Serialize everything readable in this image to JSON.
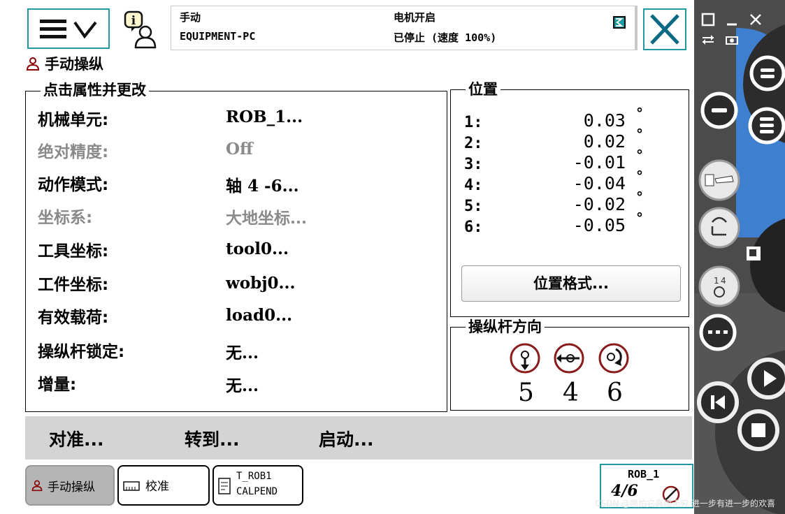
{
  "header": {
    "mode": "手动",
    "system": "EQUIPMENT-PC",
    "motor_state": "电机开启",
    "run_state": "已停止 (速度 100%)"
  },
  "page": {
    "title": "手动操纵"
  },
  "properties": {
    "group_title": "点击属性并更改",
    "rows": [
      {
        "label": "机械单元:",
        "value": "ROB_1...",
        "enabled": true
      },
      {
        "label": "绝对精度:",
        "value": "Off",
        "enabled": false
      },
      {
        "label": "动作模式:",
        "value": "轴 4 -6...",
        "enabled": true
      },
      {
        "label": "坐标系:",
        "value": "大地坐标...",
        "enabled": false
      },
      {
        "label": "工具坐标:",
        "value": "tool0...",
        "enabled": true
      },
      {
        "label": "工件坐标:",
        "value": "wobj0...",
        "enabled": true
      },
      {
        "label": "有效载荷:",
        "value": "load0...",
        "enabled": true
      },
      {
        "label": "操纵杆锁定:",
        "value": "无...",
        "enabled": true
      },
      {
        "label": "增量:",
        "value": "无...",
        "enabled": true
      }
    ]
  },
  "position": {
    "group_title": "位置",
    "unit": "°",
    "rows": [
      {
        "index": "1:",
        "value": "0.03"
      },
      {
        "index": "2:",
        "value": "0.02"
      },
      {
        "index": "3:",
        "value": "-0.01"
      },
      {
        "index": "4:",
        "value": "-0.04"
      },
      {
        "index": "5:",
        "value": "-0.02"
      },
      {
        "index": "6:",
        "value": "-0.05"
      }
    ],
    "format_button": "位置格式..."
  },
  "joystick": {
    "group_title": "操纵杆方向",
    "axes": [
      "5",
      "4",
      "6"
    ]
  },
  "commands": [
    "对准...",
    "转到...",
    "启动..."
  ],
  "taskbar": {
    "jog_label": "手动操纵",
    "calib_label": "校准",
    "task_line1": "T_ROB1",
    "task_line2": "CALPEND",
    "unit_label": "ROB_1",
    "unit_mode": "4/6"
  },
  "watermark": "CSDN @哪怕它真理无穷 进一步有进一步的欢喜",
  "colors": {
    "accent": "#1e9aa0",
    "pendant_blue": "#3f7fd0",
    "command_bar": "#d4d4d4"
  },
  "icons": [
    "menu-icon",
    "chevron-down-icon",
    "info-user-icon",
    "close-icon",
    "jog-user-icon",
    "calibration-icon",
    "program-icon",
    "window-icon",
    "minimize-icon",
    "swap-icon",
    "camera-icon"
  ]
}
